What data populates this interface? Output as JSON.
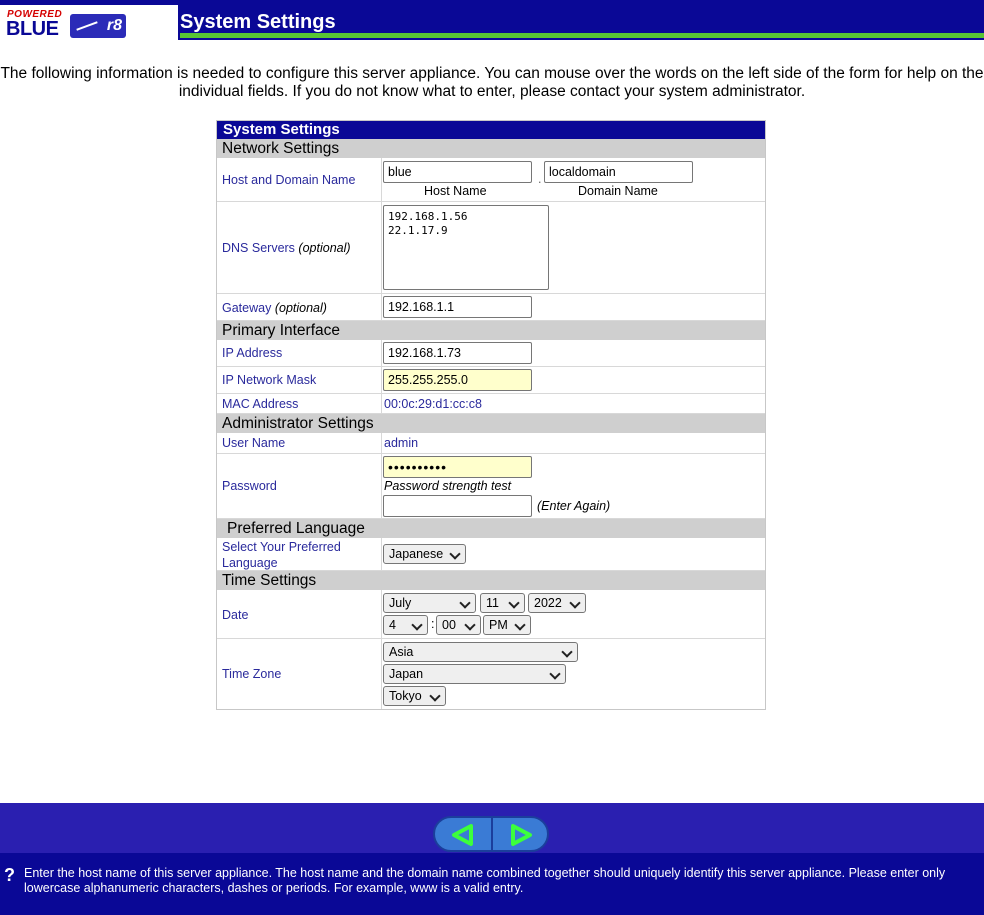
{
  "header": {
    "logo_powered": "POWERED",
    "logo_blue": "BLUE",
    "logo_version": "r8",
    "title": "System Settings"
  },
  "intro": "The following information is needed to configure this server appliance. You can mouse over the words on the left side of the form for help on the individual fields. If you do not know what to enter, please contact your system administrator.",
  "form": {
    "title": "System Settings",
    "network": {
      "section": "Network Settings",
      "host_label": "Host and Domain Name",
      "host_value": "blue",
      "host_caption": "Host Name",
      "domain_value": "localdomain",
      "domain_caption": "Domain Name",
      "dns_label": "DNS Servers",
      "dns_optional": "(optional)",
      "dns_value": "192.168.1.56\n22.1.17.9",
      "gateway_label": "Gateway",
      "gateway_optional": "(optional)",
      "gateway_value": "192.168.1.1"
    },
    "primary": {
      "section": "Primary Interface",
      "ip_label": "IP Address",
      "ip_value": "192.168.1.73",
      "mask_label": "IP Network Mask",
      "mask_value": "255.255.255.0",
      "mac_label": "MAC Address",
      "mac_value": "00:0c:29:d1:cc:c8"
    },
    "admin": {
      "section": "Administrator Settings",
      "user_label": "User Name",
      "user_value": "admin",
      "password_label": "Password",
      "password_value": "••••••••••",
      "strength_text": "Password strength test",
      "enter_again": "(Enter Again)"
    },
    "language": {
      "section": "Preferred Language",
      "label": "Select Your Preferred Language",
      "selected": "Japanese"
    },
    "time": {
      "section": "Time Settings",
      "date_label": "Date",
      "month": "July",
      "day": "11",
      "year": "2022",
      "hour": "4",
      "minute": "00",
      "ampm": "PM",
      "tz_label": "Time Zone",
      "region": "Asia",
      "country": "Japan",
      "city": "Tokyo"
    }
  },
  "footer": {
    "back_icon": "triangle-left-icon",
    "next_icon": "triangle-right-icon",
    "help_icon": "question-mark-icon",
    "help_text": "Enter the host name of this server appliance. The host name and the domain name combined together should uniquely identify this server appliance. Please enter only lowercase alphanumeric characters, dashes or periods. For example, www is a valid entry."
  },
  "colors": {
    "header_bg": "#0a0896",
    "accent_green": "#58c534",
    "footer_bg": "#2a1fb0",
    "label_blue": "#2a2a9c",
    "section_gray": "#cfcfcf",
    "highlight_yellow": "#ffffcc",
    "nav_button": "#3a7bd5",
    "nav_arrow": "#3cff3c"
  }
}
